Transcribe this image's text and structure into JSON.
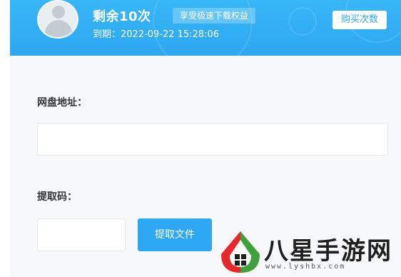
{
  "header": {
    "remaining_label": "剩余10次",
    "badge_label": "享受极速下载权益",
    "expiry_text": "到期：2022-09-22 15:28:06",
    "buy_button_label": "购买次数",
    "avatar_icon": "user-avatar-icon"
  },
  "form": {
    "url_label": "网盘地址：",
    "url_value": "",
    "code_label": "提取码：",
    "code_value": "",
    "extract_button_label": "提取文件"
  },
  "watermark": {
    "text": "八星手游网",
    "url": "www.lyshbx.com"
  },
  "colors": {
    "header_bg": "#2ea8f2",
    "accent": "#2ea8f2",
    "background": "#f7f8fa"
  }
}
